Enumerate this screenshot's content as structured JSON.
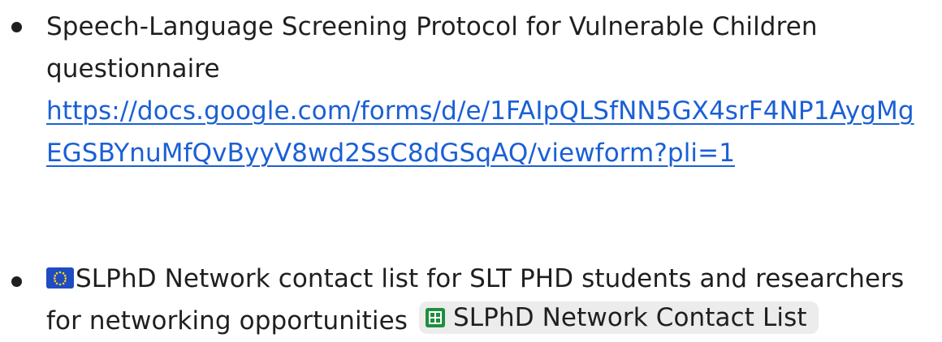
{
  "items": [
    {
      "lines": [
        "Speech-Language Screening Protocol for Vulnerable Children",
        "questionnaire"
      ],
      "link_lines": [
        "https://docs.google.com/forms/d/e/1FAIpQLSfNN5GX4srF4NP1AygMg",
        "EGSBYnuMfQvByyV8wd2SsC8dGSqAQ/viewform?pli=1"
      ]
    },
    {
      "flag_icon": "eu-flag-icon",
      "line1": "SLPhD Network contact list for SLT PHD students and researchers",
      "line2": "for networking opportunities",
      "chip": {
        "icon": "google-sheets-icon",
        "label": "SLPhD Network Contact List"
      }
    }
  ],
  "colors": {
    "text": "#1f1f1f",
    "link": "#1a5fd6",
    "chip_bg": "#ececec",
    "sheets_green": "#1e8e3e",
    "eu_blue": "#1f4cc2"
  }
}
